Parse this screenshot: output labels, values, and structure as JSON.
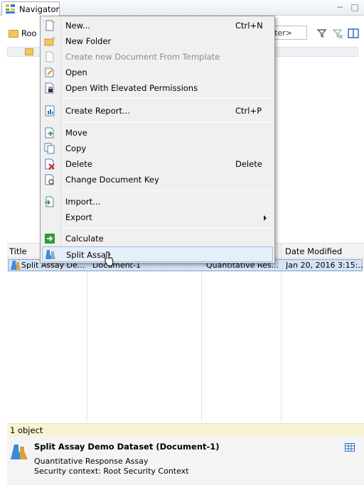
{
  "view": {
    "tab_label": "Navigator",
    "icon": "navigator-icon",
    "minimize_glyph": "▭",
    "maximize_glyph": "☐"
  },
  "toolbar": {
    "root_label": "Roo",
    "filter_placeholder": "lter>"
  },
  "table": {
    "headers": [
      "Title",
      "Date Modified"
    ],
    "row": {
      "title": "Split Assay De...",
      "key": "Document-1",
      "type": "Quantitative Res...",
      "date": "Jan 20, 2016 3:15:..."
    }
  },
  "status": {
    "count": "1 object"
  },
  "details": {
    "title": "Split Assay Demo Dataset (Document-1)",
    "line1": "Quantitative Response Assay",
    "line2": "Security context: Root Security Context"
  },
  "menu": {
    "items": [
      {
        "label": "New...",
        "shortcut": "Ctrl+N",
        "icon": "new-document-icon"
      },
      {
        "label": "New Folder",
        "shortcut": "",
        "icon": "new-folder-icon"
      },
      {
        "label": "Create new Document From Template",
        "shortcut": "",
        "icon": "template-icon",
        "disabled": true
      },
      {
        "label": "Open",
        "shortcut": "",
        "icon": "open-icon"
      },
      {
        "label": "Open With Elevated Permissions",
        "shortcut": "",
        "icon": "lock-document-icon"
      },
      {
        "label": "Create Report...",
        "shortcut": "Ctrl+P",
        "icon": "report-icon"
      },
      {
        "label": "Move",
        "shortcut": "",
        "icon": "move-icon"
      },
      {
        "label": "Copy",
        "shortcut": "",
        "icon": "copy-icon"
      },
      {
        "label": "Delete",
        "shortcut": "Delete",
        "icon": "delete-icon"
      },
      {
        "label": "Change Document Key",
        "shortcut": "",
        "icon": "key-icon"
      },
      {
        "label": "Import...",
        "shortcut": "",
        "icon": "import-icon"
      },
      {
        "label": "Export",
        "shortcut": "",
        "icon": "export-icon"
      },
      {
        "label": "Calculate",
        "shortcut": "",
        "icon": "calculate-icon"
      },
      {
        "label": "Split Assay",
        "shortcut": "",
        "icon": "split-assay-icon"
      }
    ]
  },
  "colors": {
    "selection": "#d4e3f6",
    "menu_bg": "#f0f0f0",
    "status_bg": "#f8f4d2"
  }
}
